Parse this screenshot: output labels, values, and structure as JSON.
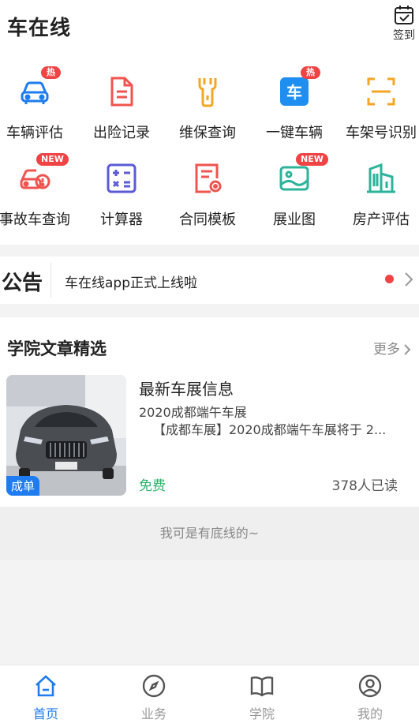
{
  "header": {
    "title": "车在线",
    "checkin_label": "签到",
    "checkin_icon": "calendar-check-icon"
  },
  "grid": [
    {
      "label": "车辆评估",
      "icon": "car-icon",
      "badge": "热",
      "color": "#1e7cf0"
    },
    {
      "label": "出险记录",
      "icon": "document-icon",
      "badge": "",
      "color": "#f0544f"
    },
    {
      "label": "维保查询",
      "icon": "wrench-icon",
      "badge": "",
      "color": "#f5a623"
    },
    {
      "label": "一键车辆",
      "icon": "car-char-icon",
      "badge": "热",
      "color": "#1e8ff0",
      "icon_text": "车"
    },
    {
      "label": "车架号识别",
      "icon": "scan-icon",
      "badge": "",
      "color": "#f5a623"
    },
    {
      "label": "事故车查询",
      "icon": "accident-car-icon",
      "badge": "NEW",
      "color": "#f0544f"
    },
    {
      "label": "计算器",
      "icon": "calculator-icon",
      "badge": "",
      "color": "#5b5bd6"
    },
    {
      "label": "合同模板",
      "icon": "contract-icon",
      "badge": "",
      "color": "#f0544f"
    },
    {
      "label": "展业图",
      "icon": "image-icon",
      "badge": "NEW",
      "color": "#2cb39a"
    },
    {
      "label": "房产评估",
      "icon": "building-icon",
      "badge": "",
      "color": "#2cb39a"
    }
  ],
  "notice": {
    "title": "公告",
    "text": "车在线app正式上线啦"
  },
  "articles": {
    "title": "学院文章精选",
    "more_label": "更多",
    "items": [
      {
        "title": "最新车展信息",
        "subtitle": "2020成都端午车展",
        "desc": "【成都车展】2020成都端午车展将于 2...",
        "tag": "成单",
        "price": "免费",
        "reads": "378人已读"
      }
    ]
  },
  "bottom_note": "我可是有底线的~",
  "tabs": [
    {
      "label": "首页",
      "icon": "home-icon",
      "active": true
    },
    {
      "label": "业务",
      "icon": "compass-icon",
      "active": false
    },
    {
      "label": "学院",
      "icon": "book-icon",
      "active": false
    },
    {
      "label": "我的",
      "icon": "user-icon",
      "active": false
    }
  ],
  "colors": {
    "accent": "#1e7cf0",
    "badge": "#f04343",
    "free": "#2cb36b"
  }
}
